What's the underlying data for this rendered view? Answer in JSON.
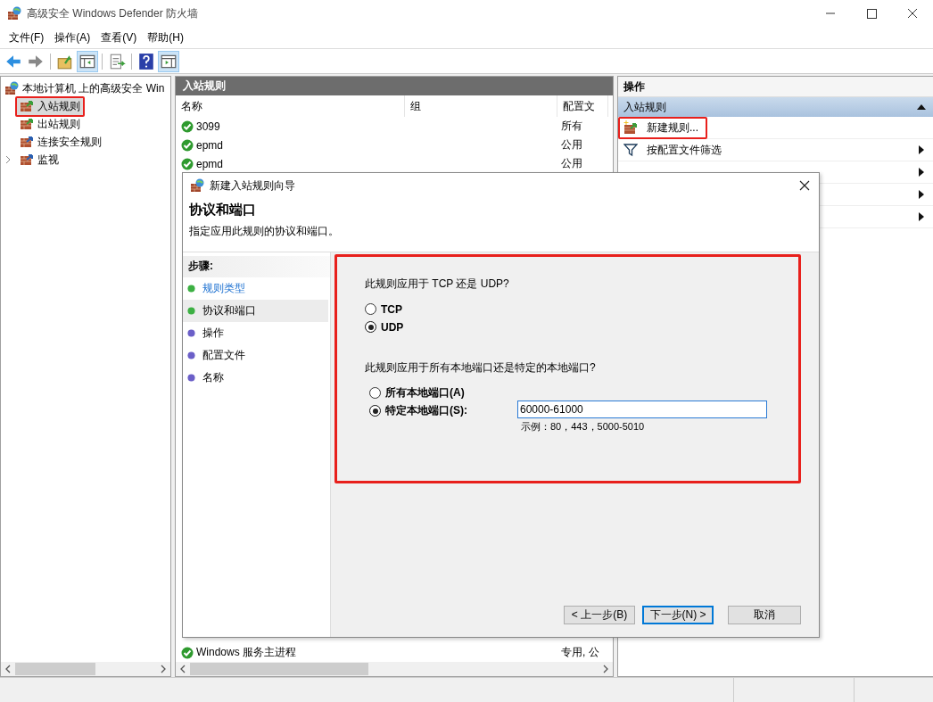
{
  "window": {
    "title": "高级安全 Windows Defender 防火墙"
  },
  "menu": [
    "文件(F)",
    "操作(A)",
    "查看(V)",
    "帮助(H)"
  ],
  "tree": {
    "root": "本地计算机 上的高级安全 Win",
    "items": [
      {
        "label": "入站规则",
        "kind": "inbound",
        "selected": true,
        "highlighted": true
      },
      {
        "label": "出站规则",
        "kind": "outbound",
        "selected": false,
        "highlighted": false
      },
      {
        "label": "连接安全规则",
        "kind": "connection",
        "selected": false,
        "highlighted": false
      },
      {
        "label": "监视",
        "kind": "monitor",
        "selected": false,
        "highlighted": false,
        "expandable": true
      }
    ]
  },
  "rules_panel": {
    "title": "入站规则",
    "columns": [
      "名称",
      "组",
      "配置文"
    ],
    "rows": [
      {
        "name": "3099",
        "profile": "所有"
      },
      {
        "name": "epmd",
        "profile": "公用"
      },
      {
        "name": "epmd",
        "profile": "公用"
      },
      {
        "name": "Windows 服务主进程",
        "profile": "专用, 公"
      }
    ]
  },
  "actions": {
    "title": "操作",
    "section": "入站规则",
    "expanded": true,
    "items": [
      {
        "label": "新建规则...",
        "kind": "new",
        "submenu": false,
        "highlighted": true
      },
      {
        "label": "按配置文件筛选",
        "kind": "filter",
        "submenu": true,
        "highlighted": false
      },
      {
        "kind": "filter",
        "submenu": true
      },
      {
        "kind": "blank",
        "submenu": true
      },
      {
        "kind": "blank",
        "submenu": true
      }
    ]
  },
  "dialog": {
    "title": "新建入站规则向导",
    "heading": "协议和端口",
    "subtitle": "指定应用此规则的协议和端口。",
    "steps_title": "步骤:",
    "steps": [
      {
        "label": "规则类型",
        "completed": true,
        "selected": false
      },
      {
        "label": "协议和端口",
        "completed": true,
        "selected": true
      },
      {
        "label": "操作",
        "completed": false,
        "selected": false
      },
      {
        "label": "配置文件",
        "completed": false,
        "selected": false
      },
      {
        "label": "名称",
        "completed": false,
        "selected": false
      }
    ],
    "highlighted": true,
    "protocol": {
      "question": "此规则应用于 TCP 还是 UDP?",
      "options": [
        {
          "label": "TCP",
          "selected": false
        },
        {
          "label": "UDP",
          "selected": true
        }
      ]
    },
    "ports": {
      "question": "此规则应用于所有本地端口还是特定的本地端口?",
      "options": [
        {
          "label": "所有本地端口(A)",
          "selected": false
        },
        {
          "label": "特定本地端口(S):",
          "selected": true
        }
      ],
      "value": "60000-61000",
      "example": "示例：80，443，5000-5010"
    },
    "buttons": [
      {
        "label": "< 上一步(B)",
        "default": false
      },
      {
        "label": "下一步(N) >",
        "default": true
      },
      {
        "label": "取消",
        "default": false
      }
    ]
  }
}
